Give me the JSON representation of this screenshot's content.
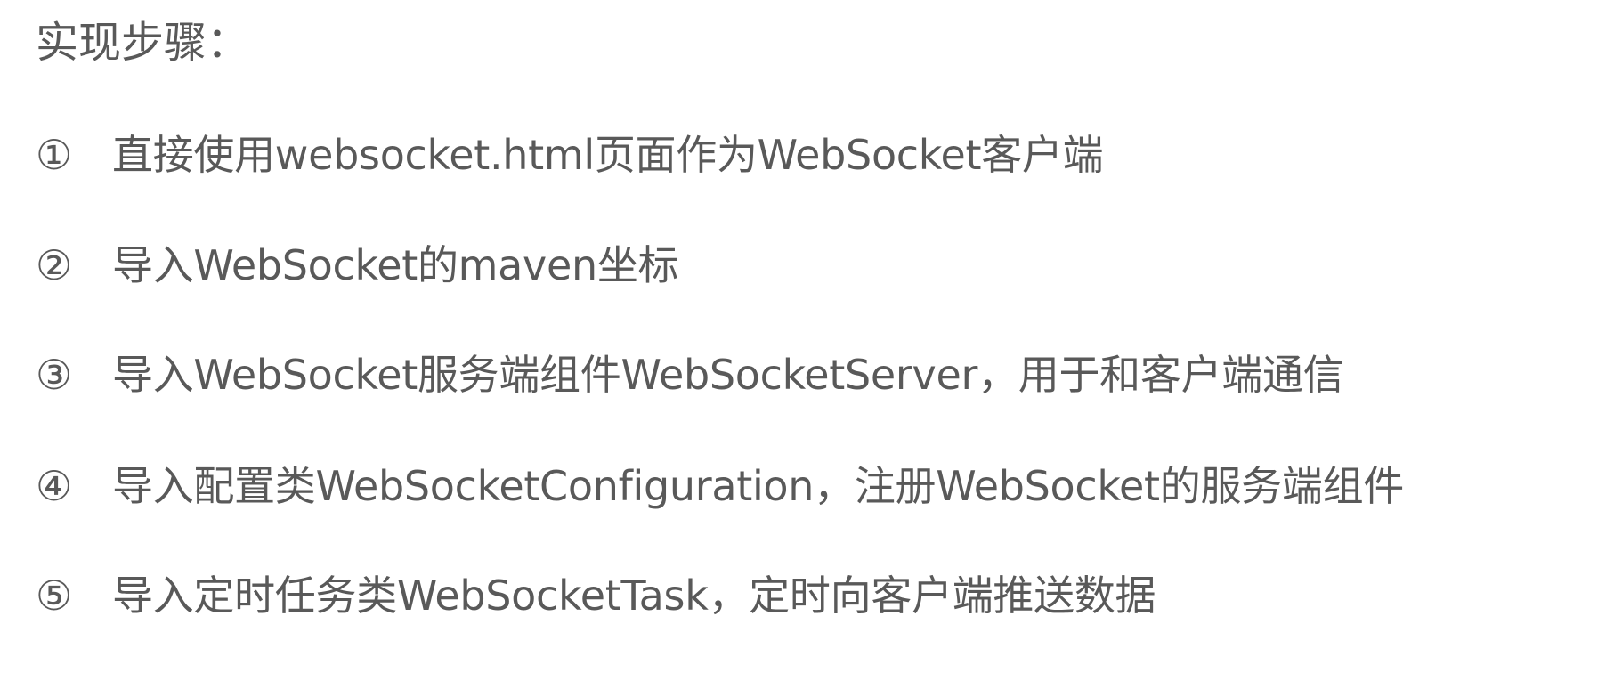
{
  "heading": "实现步骤：",
  "steps": [
    {
      "marker": "①",
      "text": "直接使用websocket.html页面作为WebSocket客户端"
    },
    {
      "marker": "②",
      "text": "导入WebSocket的maven坐标"
    },
    {
      "marker": "③",
      "text": "导入WebSocket服务端组件WebSocketServer，用于和客户端通信"
    },
    {
      "marker": "④",
      "text": "导入配置类WebSocketConfiguration，注册WebSocket的服务端组件"
    },
    {
      "marker": "⑤",
      "text": "导入定时任务类WebSocketTask，定时向客户端推送数据"
    }
  ]
}
